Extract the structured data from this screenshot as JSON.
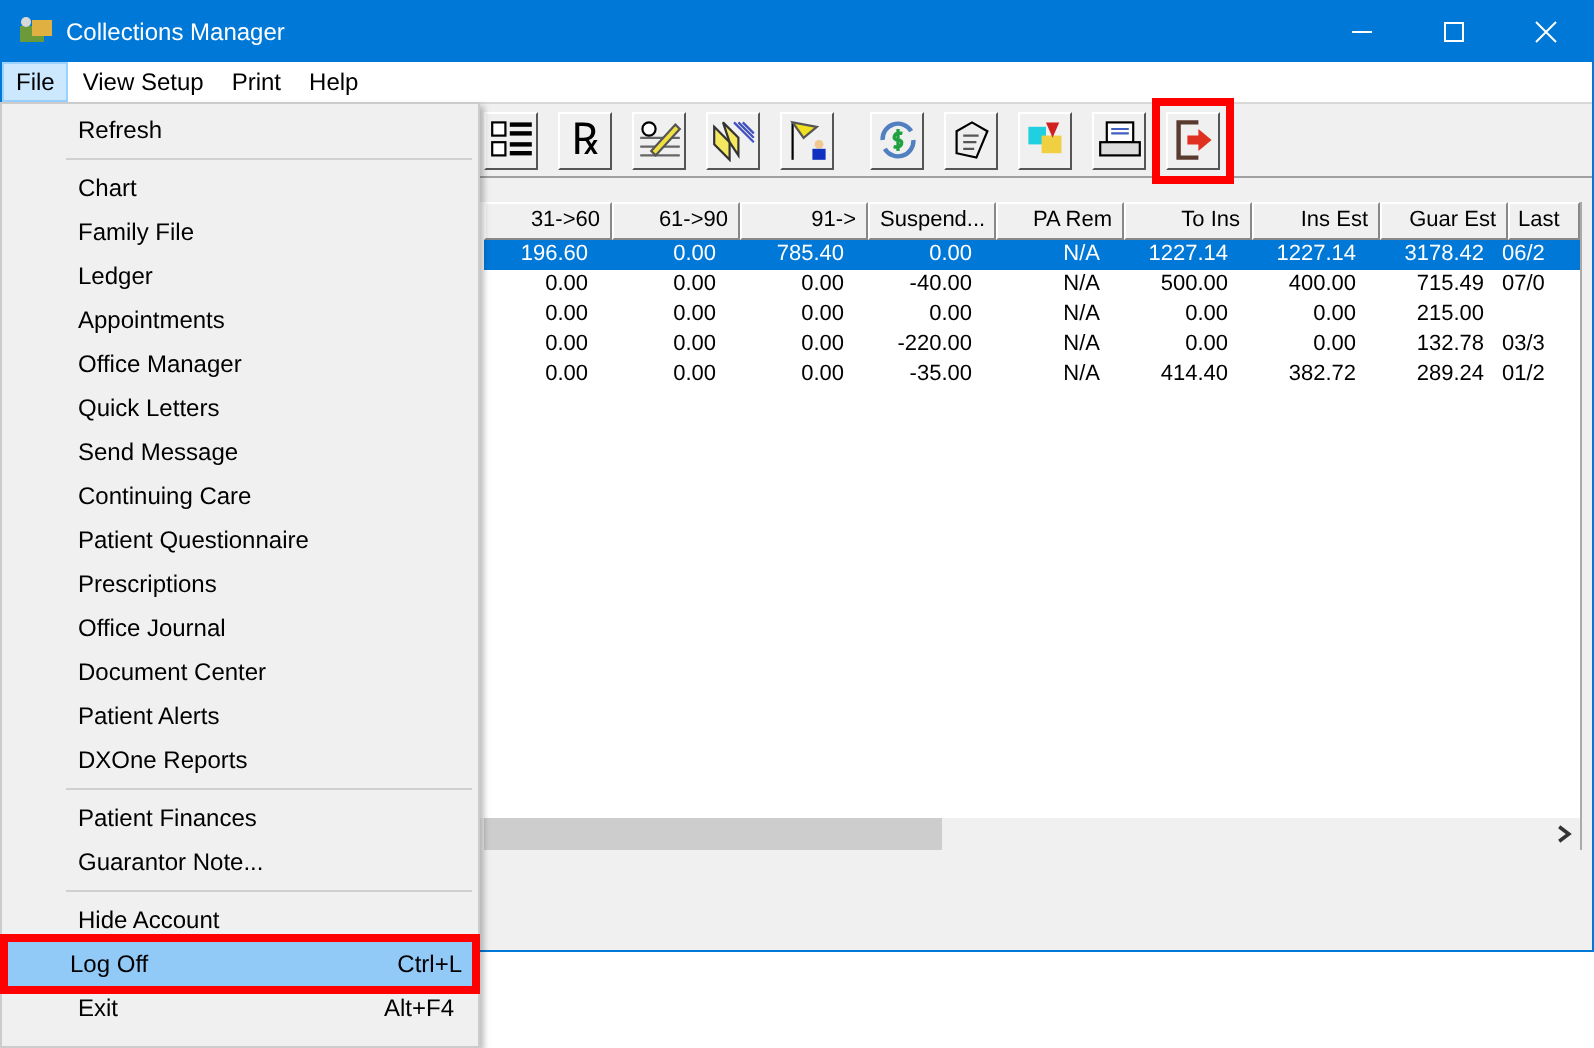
{
  "window": {
    "title": "Collections Manager"
  },
  "menubar": [
    {
      "label": "File",
      "selected": true
    },
    {
      "label": "View Setup",
      "selected": false
    },
    {
      "label": "Print",
      "selected": false
    },
    {
      "label": "Help",
      "selected": false
    }
  ],
  "toolbar": {
    "groups": [
      [
        {
          "kind": "list",
          "highlighted": false
        },
        {
          "kind": "rx",
          "symbol": "℞",
          "highlighted": false
        },
        {
          "kind": "pencil",
          "highlighted": false
        },
        {
          "kind": "folders",
          "highlighted": false
        },
        {
          "kind": "flag",
          "highlighted": false
        }
      ],
      [
        {
          "kind": "dollar",
          "highlighted": false
        },
        {
          "kind": "document",
          "highlighted": false
        },
        {
          "kind": "colors",
          "highlighted": false
        },
        {
          "kind": "printer",
          "highlighted": false
        },
        {
          "kind": "exit",
          "highlighted": true
        }
      ]
    ]
  },
  "table": {
    "columns": [
      "31->60",
      "61->90",
      "91->",
      "Suspend...",
      "PA Rem",
      "To Ins",
      "Ins Est",
      "Guar Est",
      "Last"
    ],
    "rows": [
      {
        "selected": true,
        "cells": [
          "196.60",
          "0.00",
          "785.40",
          "0.00",
          "N/A",
          "1227.14",
          "1227.14",
          "3178.42",
          "06/2"
        ]
      },
      {
        "selected": false,
        "cells": [
          "0.00",
          "0.00",
          "0.00",
          "-40.00",
          "N/A",
          "500.00",
          "400.00",
          "715.49",
          "07/0"
        ]
      },
      {
        "selected": false,
        "cells": [
          "0.00",
          "0.00",
          "0.00",
          "0.00",
          "N/A",
          "0.00",
          "0.00",
          "215.00",
          ""
        ]
      },
      {
        "selected": false,
        "cells": [
          "0.00",
          "0.00",
          "0.00",
          "-220.00",
          "N/A",
          "0.00",
          "0.00",
          "132.78",
          "03/3"
        ]
      },
      {
        "selected": false,
        "cells": [
          "0.00",
          "0.00",
          "0.00",
          "-35.00",
          "N/A",
          "414.40",
          "382.72",
          "289.24",
          "01/2"
        ]
      }
    ]
  },
  "file_menu": {
    "groups": [
      [
        {
          "label": "Refresh",
          "selected": false,
          "highlighted": false
        }
      ],
      [
        {
          "label": "Chart",
          "selected": false,
          "highlighted": false
        },
        {
          "label": "Family File",
          "selected": false,
          "highlighted": false
        },
        {
          "label": "Ledger",
          "selected": false,
          "highlighted": false
        },
        {
          "label": "Appointments",
          "selected": false,
          "highlighted": false
        },
        {
          "label": "Office Manager",
          "selected": false,
          "highlighted": false
        },
        {
          "label": "Quick Letters",
          "selected": false,
          "highlighted": false
        },
        {
          "label": "Send Message",
          "selected": false,
          "highlighted": false
        },
        {
          "label": "Continuing Care",
          "selected": false,
          "highlighted": false
        },
        {
          "label": "Patient Questionnaire",
          "selected": false,
          "highlighted": false
        },
        {
          "label": "Prescriptions",
          "selected": false,
          "highlighted": false
        },
        {
          "label": "Office Journal",
          "selected": false,
          "highlighted": false
        },
        {
          "label": "Document Center",
          "selected": false,
          "highlighted": false
        },
        {
          "label": "Patient Alerts",
          "selected": false,
          "highlighted": false
        },
        {
          "label": "DXOne Reports",
          "selected": false,
          "highlighted": false
        }
      ],
      [
        {
          "label": "Patient Finances",
          "selected": false,
          "highlighted": false
        },
        {
          "label": "Guarantor Note...",
          "selected": false,
          "highlighted": false
        }
      ],
      [
        {
          "label": "Hide Account",
          "selected": false,
          "highlighted": false
        },
        {
          "label": "Log Off",
          "shortcut": "Ctrl+L",
          "selected": true,
          "highlighted": true
        },
        {
          "label": "Exit",
          "shortcut": "Alt+F4",
          "selected": false,
          "highlighted": false
        }
      ]
    ]
  }
}
